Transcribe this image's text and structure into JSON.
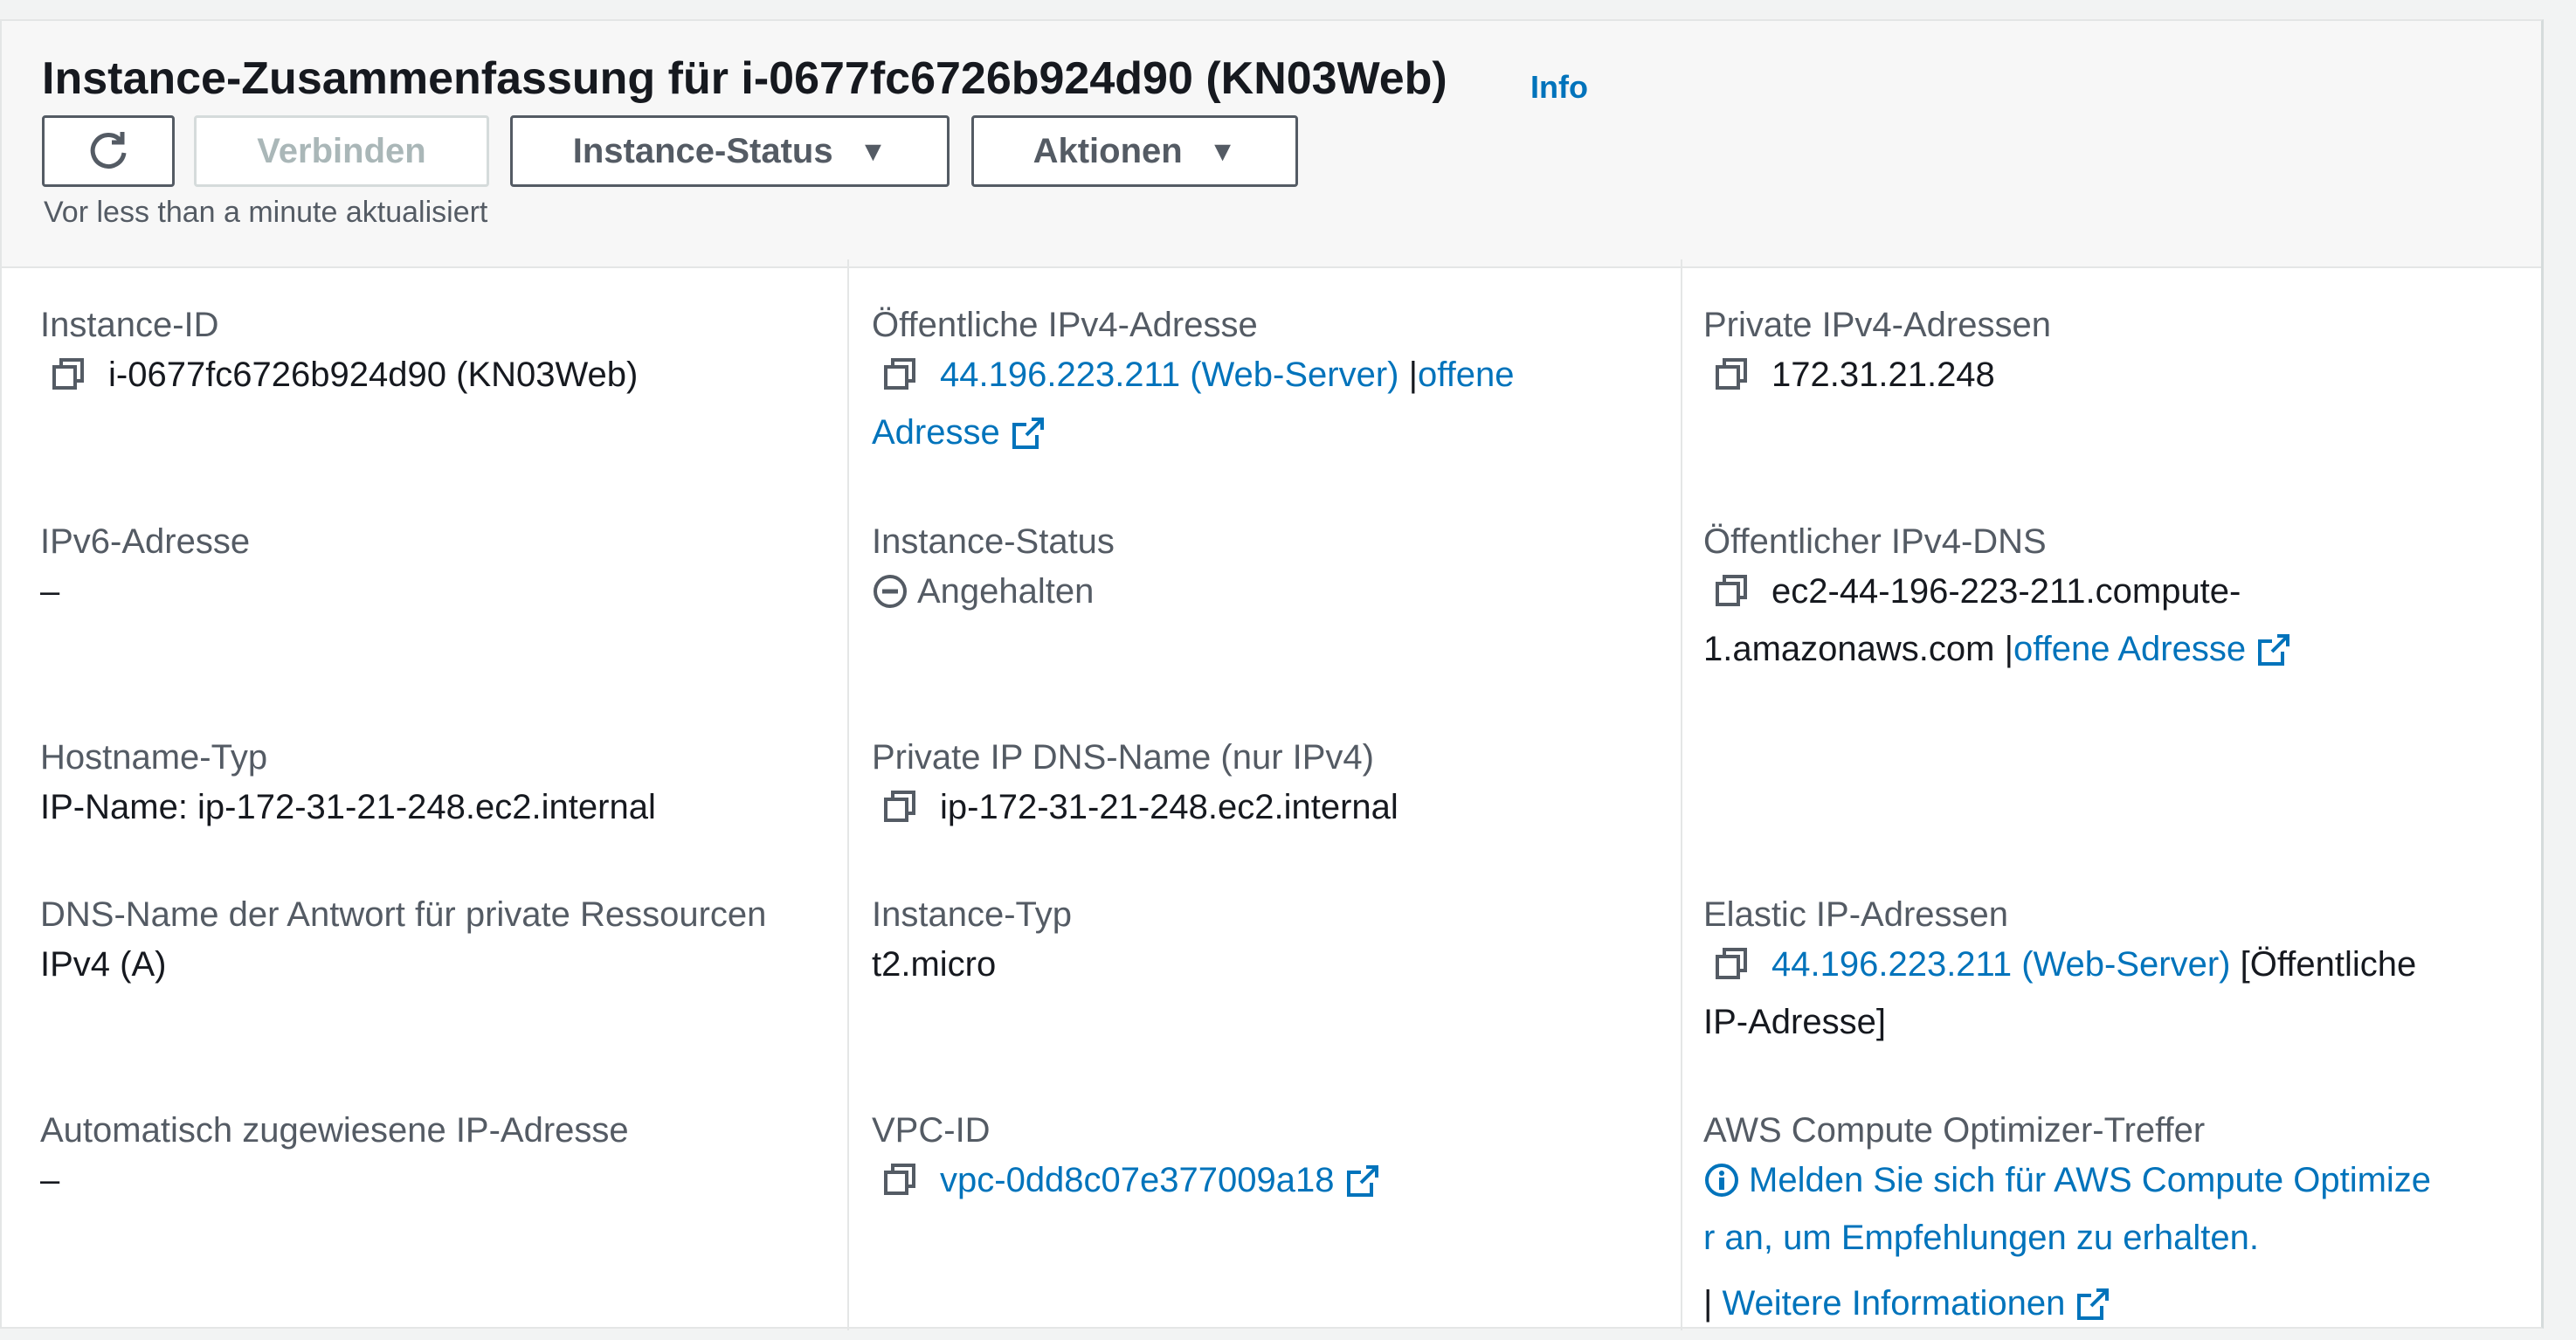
{
  "header": {
    "title": "Instance-Zusammenfassung für i-0677fc6726b924d90 (KN03Web)",
    "info": "Info",
    "buttons": {
      "refresh_icon": "refresh-icon",
      "connect": "Verbinden",
      "instance_status": "Instance-Status",
      "actions": "Aktionen"
    },
    "updated": "Vor less than a minute aktualisiert"
  },
  "col1": {
    "instance_id": {
      "label": "Instance-ID",
      "value": "i-0677fc6726b924d90 (KN03Web)"
    },
    "ipv6": {
      "label": "IPv6-Adresse",
      "value": "–"
    },
    "hostname_type": {
      "label": "Hostname-Typ",
      "value": "IP-Name: ip-172-31-21-248.ec2.internal"
    },
    "dns_answer": {
      "label": "DNS-Name der Antwort für private Ressourcen",
      "value": "IPv4 (A)"
    },
    "auto_ip": {
      "label": "Automatisch zugewiesene IP-Adresse",
      "value": "–"
    }
  },
  "col2": {
    "public_ipv4": {
      "label": "Öffentliche IPv4-Adresse",
      "link": "44.196.223.211 (Web-Server)",
      "sep": " |",
      "open1": "offene",
      "open2": "Adresse"
    },
    "instance_status": {
      "label": "Instance-Status",
      "value": "Angehalten"
    },
    "private_dns": {
      "label": "Private IP DNS-Name (nur IPv4)",
      "value": "ip-172-31-21-248.ec2.internal"
    },
    "instance_type": {
      "label": "Instance-Typ",
      "value": "t2.micro"
    },
    "vpc": {
      "label": "VPC-ID",
      "link": "vpc-0dd8c07e377009a18"
    }
  },
  "col3": {
    "private_ipv4": {
      "label": "Private IPv4-Adressen",
      "value": "172.31.21.248"
    },
    "public_dns": {
      "label": "Öffentlicher IPv4-DNS",
      "line1": "ec2-44-196-223-211.compute-",
      "line2": "1.amazonaws.com |",
      "open": "offene Adresse"
    },
    "elastic_ip": {
      "label": "Elastic IP-Adressen",
      "link": "44.196.223.211 (Web-Server)",
      "suffix": " [Öffentliche",
      "line2": "IP-Adresse]"
    },
    "optimizer": {
      "label": "AWS Compute Optimizer-Treffer",
      "line1": "Melden Sie sich für AWS Compute Optimize",
      "line2": "r an, um Empfehlungen zu erhalten.",
      "sep": "| ",
      "more": "Weitere Informationen"
    }
  },
  "colors": {
    "link": "#0073bb",
    "text": "#16191f",
    "label": "#545b64",
    "border": "#e4e6e6"
  }
}
